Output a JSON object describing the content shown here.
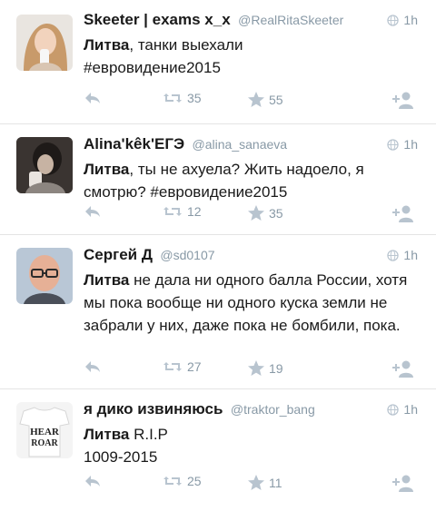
{
  "tweets": [
    {
      "name": "Skeeter | exams x_x",
      "handle": "@RealRitaSkeeter",
      "time": "1h",
      "bold": "Литва",
      "rest": ", танки выехали\n#евровидение2015",
      "retweets": "35",
      "favorites": "55"
    },
    {
      "name": "Alina'kêk'ЕГЭ",
      "handle": "@alina_sanaeva",
      "time": "1h",
      "bold": "Литва",
      "rest": ", ты не ахуела? Жить надоело, я смотрю? #евровидение2015",
      "retweets": "12",
      "favorites": "35"
    },
    {
      "name": "Сергей Д",
      "handle": "@sd0107",
      "time": "1h",
      "bold": "Литва",
      "rest": " не дала ни одного балла России, хотя мы пока вообще ни одного куска земли не забрали у них, даже пока не бомбили, пока.",
      "retweets": "27",
      "favorites": "19"
    },
    {
      "name": "я дико извиняюсь",
      "handle": "@traktor_bang",
      "time": "1h",
      "bold": "Литва",
      "rest": " R.I.P\n1009-2015",
      "retweets": "25",
      "favorites": "11"
    }
  ],
  "colors": {
    "meta": "#8899a6",
    "icon": "#b8c4cf",
    "divider": "#e4e4e4"
  },
  "icons": [
    "reply-icon",
    "retweet-icon",
    "favorite-star-icon",
    "follow-icon",
    "globe-icon"
  ]
}
